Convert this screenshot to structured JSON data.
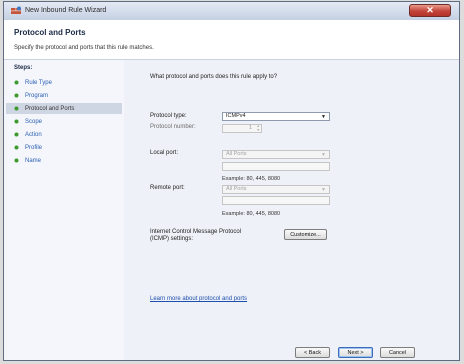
{
  "window": {
    "title": "New Inbound Rule Wizard"
  },
  "header": {
    "title": "Protocol and Ports",
    "subtitle": "Specify the protocol and ports that this rule matches."
  },
  "steps": {
    "label": "Steps:",
    "items": [
      {
        "label": "Rule Type"
      },
      {
        "label": "Program"
      },
      {
        "label": "Protocol and Ports",
        "active": true
      },
      {
        "label": "Scope"
      },
      {
        "label": "Action"
      },
      {
        "label": "Profile"
      },
      {
        "label": "Name"
      }
    ]
  },
  "main": {
    "question": "What protocol and ports does this rule apply to?",
    "protocol_type_label": "Protocol type:",
    "protocol_type_value": "ICMPv4",
    "protocol_number_label": "Protocol number:",
    "protocol_number_value": "1",
    "local_port_label": "Local port:",
    "local_port_value": "All Ports",
    "local_example": "Example: 80, 445, 8080",
    "remote_port_label": "Remote port:",
    "remote_port_value": "All Ports",
    "remote_example": "Example: 80, 445, 8080",
    "icmp_label_line1": "Internet Control Message Protocol",
    "icmp_label_line2": "(ICMP) settings:",
    "customize_label": "Customize...",
    "learn_more": "Learn more about protocol and ports"
  },
  "footer": {
    "back_label": "< Back",
    "next_label": "Next >",
    "cancel_label": "Cancel"
  },
  "colors": {
    "link": "#1d4fae",
    "close_button": "#c3443a",
    "step_bullet": "#3d9a2c"
  }
}
